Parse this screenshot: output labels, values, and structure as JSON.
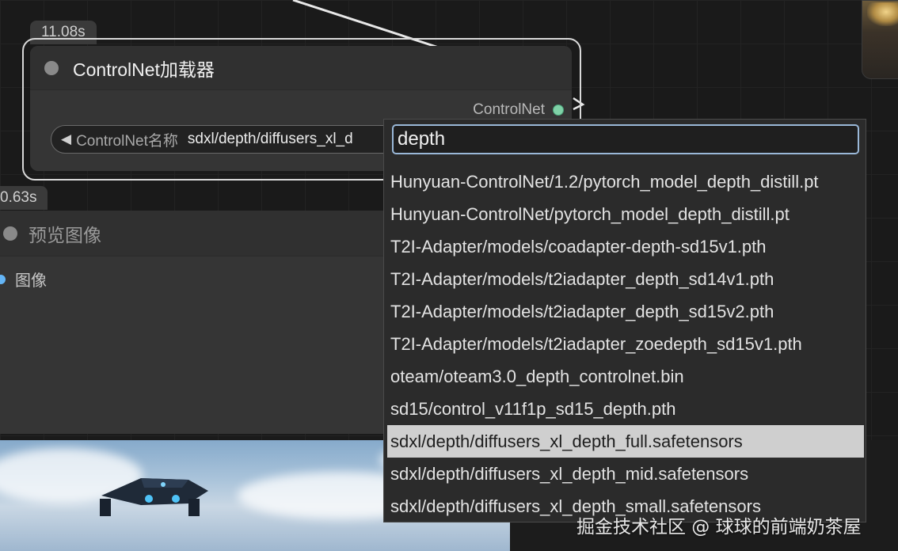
{
  "colors": {
    "accent_search_border": "#9ab8d8",
    "controlnet_slot": "#7fd1a7",
    "image_slot": "#64b5f6",
    "selected_item_bg": "#cfcfcf"
  },
  "controlnet_node": {
    "timer": "11.08s",
    "title": "ControlNet加载器",
    "output_label": "ControlNet",
    "widget": {
      "arrow": "◀",
      "label": "ControlNet名称",
      "value": "sdxl/depth/diffusers_xl_d"
    }
  },
  "preview_node": {
    "timer": "0.63s",
    "title": "预览图像",
    "input_label": "图像"
  },
  "dropdown": {
    "search_value": "depth",
    "items": [
      "Hunyuan-ControlNet/1.2/pytorch_model_depth_distill.pt",
      "Hunyuan-ControlNet/pytorch_model_depth_distill.pt",
      "T2I-Adapter/models/coadapter-depth-sd15v1.pth",
      "T2I-Adapter/models/t2iadapter_depth_sd14v1.pth",
      "T2I-Adapter/models/t2iadapter_depth_sd15v2.pth",
      "T2I-Adapter/models/t2iadapter_zoedepth_sd15v1.pth",
      "oteam/oteam3.0_depth_controlnet.bin",
      "sd15/control_v11f1p_sd15_depth.pth",
      "sdxl/depth/diffusers_xl_depth_full.safetensors",
      "sdxl/depth/diffusers_xl_depth_mid.safetensors",
      "sdxl/depth/diffusers_xl_depth_small.safetensors"
    ],
    "selected_index": 8
  },
  "watermark": "掘金技术社区 @ 球球的前端奶茶屋"
}
